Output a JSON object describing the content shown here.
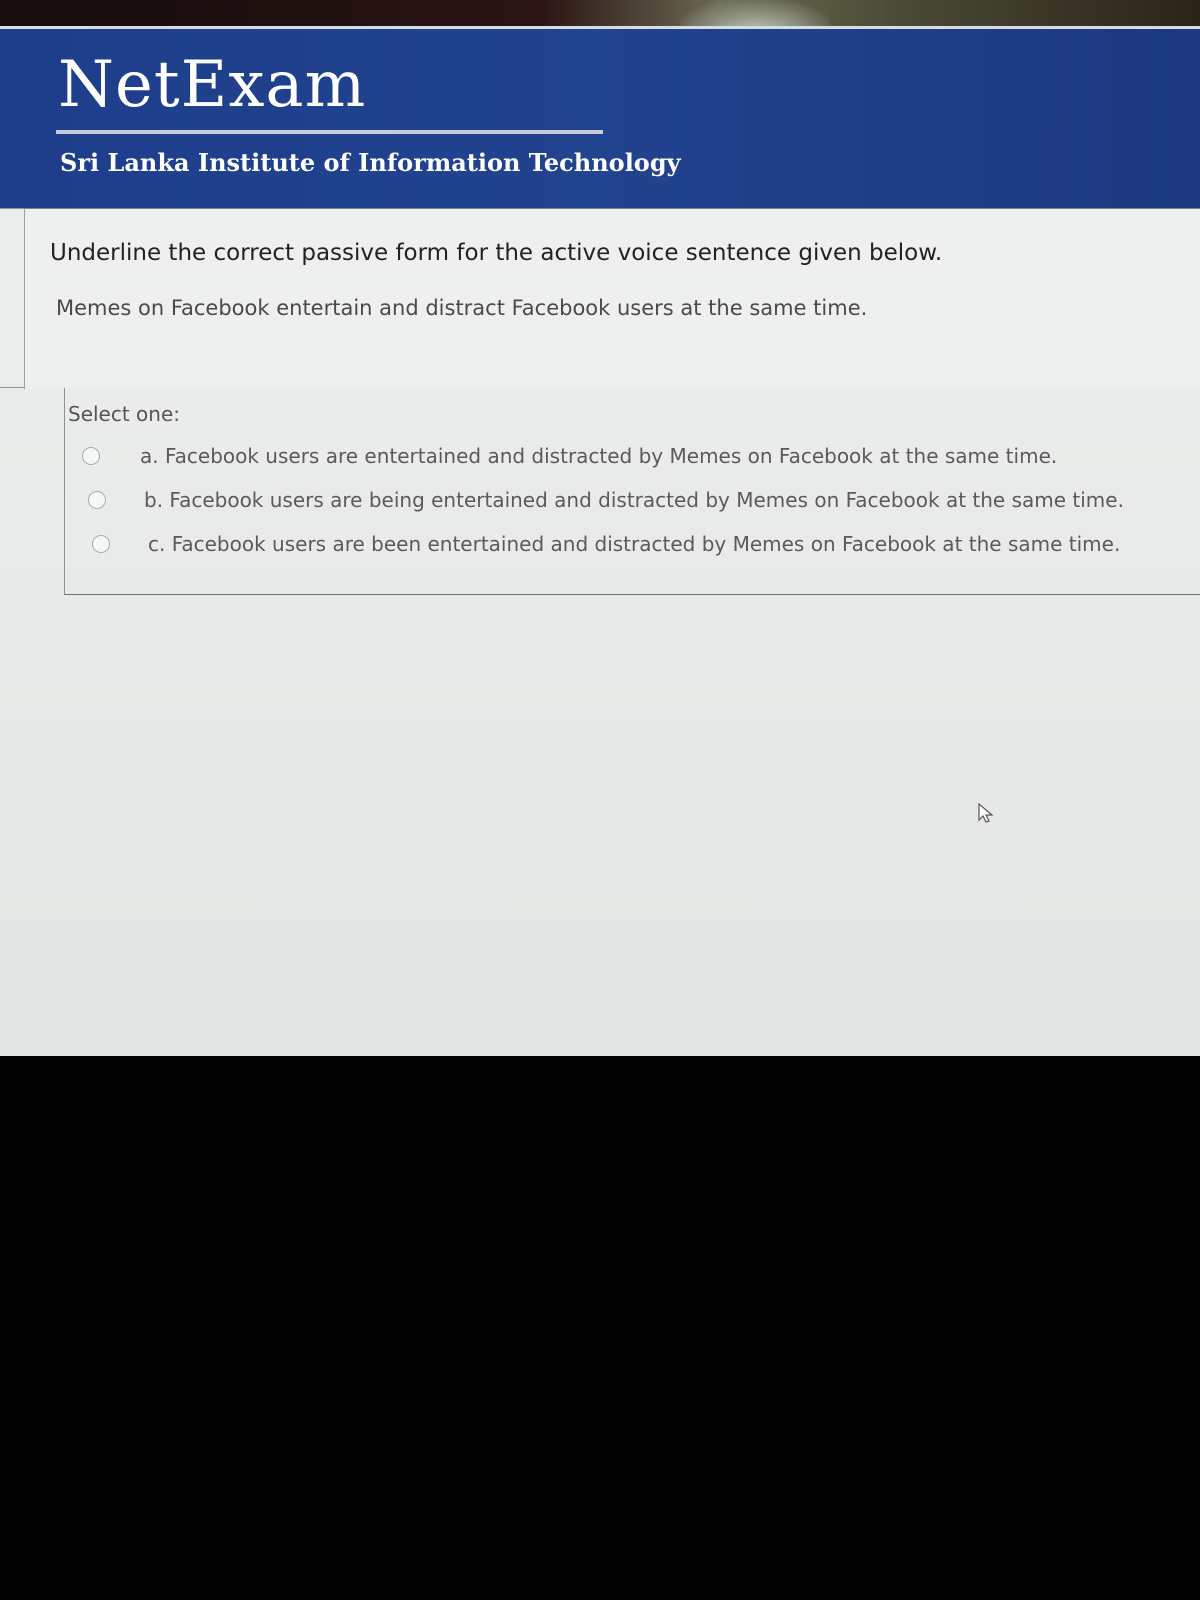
{
  "header": {
    "logo": "NetExam",
    "institute": "Sri Lanka Institute of Information Technology"
  },
  "question": {
    "instruction": "Underline the correct passive form for the active voice sentence given below.",
    "sentence": "Memes on Facebook entertain and distract Facebook users at the same time."
  },
  "answers": {
    "select_label": "Select one:",
    "options": [
      {
        "label": "a. Facebook users are entertained and distracted by Memes on Facebook  at the same time."
      },
      {
        "label": "b. Facebook users are being entertained and distracted by Memes on Facebook  at the same time."
      },
      {
        "label": "c. Facebook users are been entertained and distracted by Memes on Facebook  at the same time."
      }
    ]
  },
  "colors": {
    "header_blue": "#22438f",
    "accent_orange": "#e8772d"
  }
}
